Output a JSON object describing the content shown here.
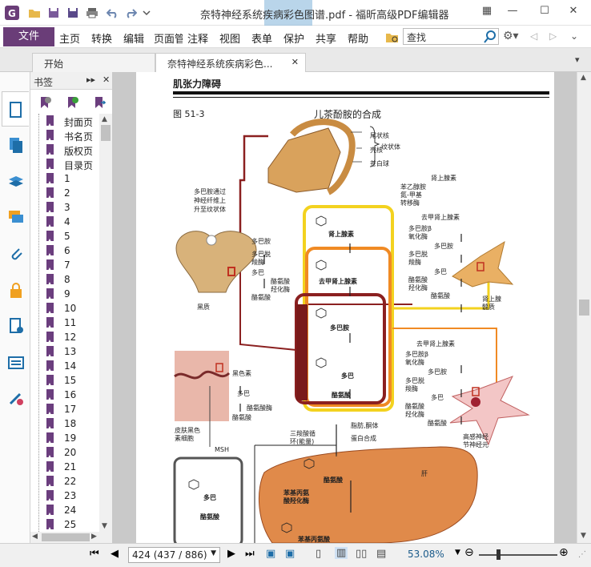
{
  "window": {
    "title": "奈特神经系统疾病彩色图谱.pdf - 福昕高级PDF编辑器"
  },
  "menu": {
    "file": "文件",
    "items": [
      "主页",
      "转换",
      "编辑",
      "页面管",
      "注释",
      "视图",
      "表单",
      "保护",
      "共享",
      "帮助"
    ],
    "search_placeholder": "查找"
  },
  "tabs": [
    {
      "label": "开始"
    },
    {
      "label": "奈特神经系统疾病彩色..."
    }
  ],
  "sidebar": {
    "title": "书签",
    "bookmarks": [
      "封面页",
      "书名页",
      "版权页",
      "目录页",
      "1",
      "2",
      "3",
      "4",
      "5",
      "6",
      "7",
      "8",
      "9",
      "10",
      "11",
      "12",
      "13",
      "14",
      "15",
      "16",
      "17",
      "18",
      "19",
      "20",
      "21",
      "22",
      "23",
      "24",
      "25"
    ]
  },
  "page": {
    "header": "肌张力障碍",
    "figure_no": "图 51-3",
    "figure_title": "儿茶酚胺的合成",
    "labels": {
      "tail": "尾状核",
      "shell": "壳核",
      "pale": "苍白球",
      "striatum": "纹状体",
      "dopa_fiber1": "多巴胺通过",
      "dopa_fiber2": "神经纤维上",
      "dopa_fiber3": "升至纹状体",
      "dopamine": "多巴胺",
      "dopa_decarb1": "多巴脱",
      "dopa_decarb2": "羧酶",
      "dopa": "多巴",
      "tyr_hydrox1": "酪氨酸",
      "tyr_hydrox2": "羟化酶",
      "tyrosine": "酪氨酸",
      "substantia": "黑质",
      "epi": "肾上腺素",
      "norepi": "去甲肾上腺素",
      "dopa_amine": "多巴胺",
      "dopa_b": "多巴",
      "tyr_b": "酪氨酸",
      "pnmt1": "苯乙醇胺",
      "pnmt2": "氮-甲基",
      "pnmt3": "转移酶",
      "r_epi": "肾上腺素",
      "r_norepi": "去甲肾上腺素",
      "r_dbh1": "多巴胺β",
      "r_dbh2": "氧化酶",
      "r_dopamine": "多巴胺",
      "r_ddc1": "多巴脱",
      "r_ddc2": "羧酶",
      "r_dopa": "多巴",
      "r_th1": "酪氨酸",
      "r_th2": "羟化酶",
      "r_tyr": "酪氨酸",
      "adrenal1": "肾上腺",
      "adrenal2": "髓质",
      "s_norepi": "去甲肾上腺素",
      "s_dbh1": "多巴胺β",
      "s_dbh2": "氧化酶",
      "s_dopamine": "多巴胺",
      "s_ddc1": "多巴脱",
      "s_ddc2": "羧酶",
      "s_dopa": "多巴",
      "s_th1": "酪氨酸",
      "s_th2": "羟化酶",
      "s_tyr": "酪氨酸",
      "symp1": "高感神经",
      "symp2": "节神经元",
      "melanin": "黑色素",
      "skin_dopa": "多巴",
      "skin_th": "酪氨酸酶",
      "skin_tyr": "酪氨酸",
      "melano1": "皮肤黑色",
      "melano2": "素细胞",
      "msh": "MSH",
      "tca1": "三羧酸循",
      "tca2": "环(能量)",
      "fat": "脂肪,酮体",
      "protein": "蛋白合成",
      "liver": "肝",
      "liver_tyr": "酪氨酸",
      "phe1": "苯基丙氨",
      "phe2": "酸羟化酶",
      "phe": "苯基丙氨酸",
      "bottom_dopa": "多巴",
      "bottom_tyr": "酪氨酸"
    }
  },
  "status": {
    "page_display": "424 (437 / 886)",
    "zoom": "53.08%"
  }
}
